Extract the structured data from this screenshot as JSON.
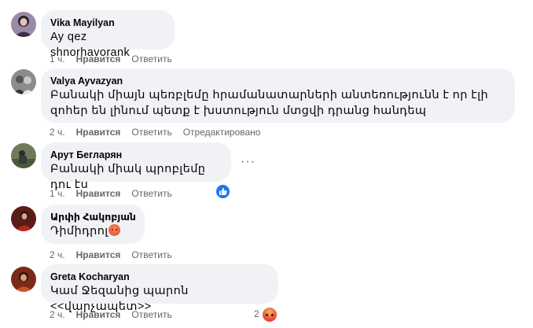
{
  "comments": [
    {
      "author": "Vika Mayilyan",
      "text": "Ay qez shnorhavorank",
      "time": "1 ч.",
      "like": "Нравится",
      "reply": "Ответить"
    },
    {
      "author": "Valya Ayvazyan",
      "text": "Բանակի միայն պեռբլեմը հրամանատարների անտեռությունն է որ էլի զոհեր են լինում պետք է խստություն մտցվի դրանց հանդեպ",
      "time": "2 ч.",
      "like": "Нравится",
      "reply": "Ответить",
      "edited": "Отредактировано"
    },
    {
      "author": "Арут Бегларян",
      "text": "Բանակի միակ պրոբլեմը դու էս",
      "time": "1 ч.",
      "like": "Нравится",
      "reply": "Ответить",
      "more": "···"
    },
    {
      "author": "Արփի Հակոբյան",
      "text": "Դիմիդրոլ",
      "time": "2 ч.",
      "like": "Нравится",
      "reply": "Ответить"
    },
    {
      "author": "Greta Kocharyan",
      "text": "Կամ Ջեզանից պարոն <<վարչապետ>>",
      "time": "2 ч.",
      "like": "Нравится",
      "reply": "Ответить",
      "reaction_count": "2"
    }
  ],
  "icons": {
    "like": "thumbs-up-icon",
    "angry": "angry-reaction-icon",
    "emoji": "angry-emoji-icon"
  },
  "colors": {
    "bubble": "#f0f2f5",
    "meta": "#65676b",
    "like_blue": "#1877f2"
  }
}
